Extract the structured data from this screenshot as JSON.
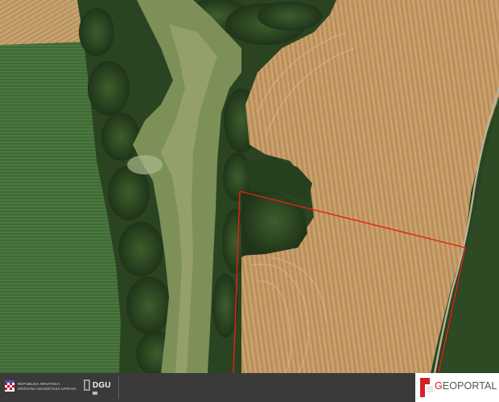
{
  "map": {
    "layer": "aerial orthophoto",
    "boundary_color": "#e32219",
    "features": [
      "crop-field-upper-left",
      "green-crop-field-left",
      "forest-strip",
      "wetland-channel",
      "harvested-wheat-field",
      "forest-patch",
      "dirt-track"
    ]
  },
  "footer": {
    "org_line1": "REPUBLIKA HRVATSKA",
    "org_line2": "DRŽAVNA GEODETSKA UPRAVA",
    "dgu_label": "DGU",
    "geoportal_prefix": "G",
    "geoportal_rest": "EOPORTAL",
    "brand_color": "#d41f26"
  }
}
